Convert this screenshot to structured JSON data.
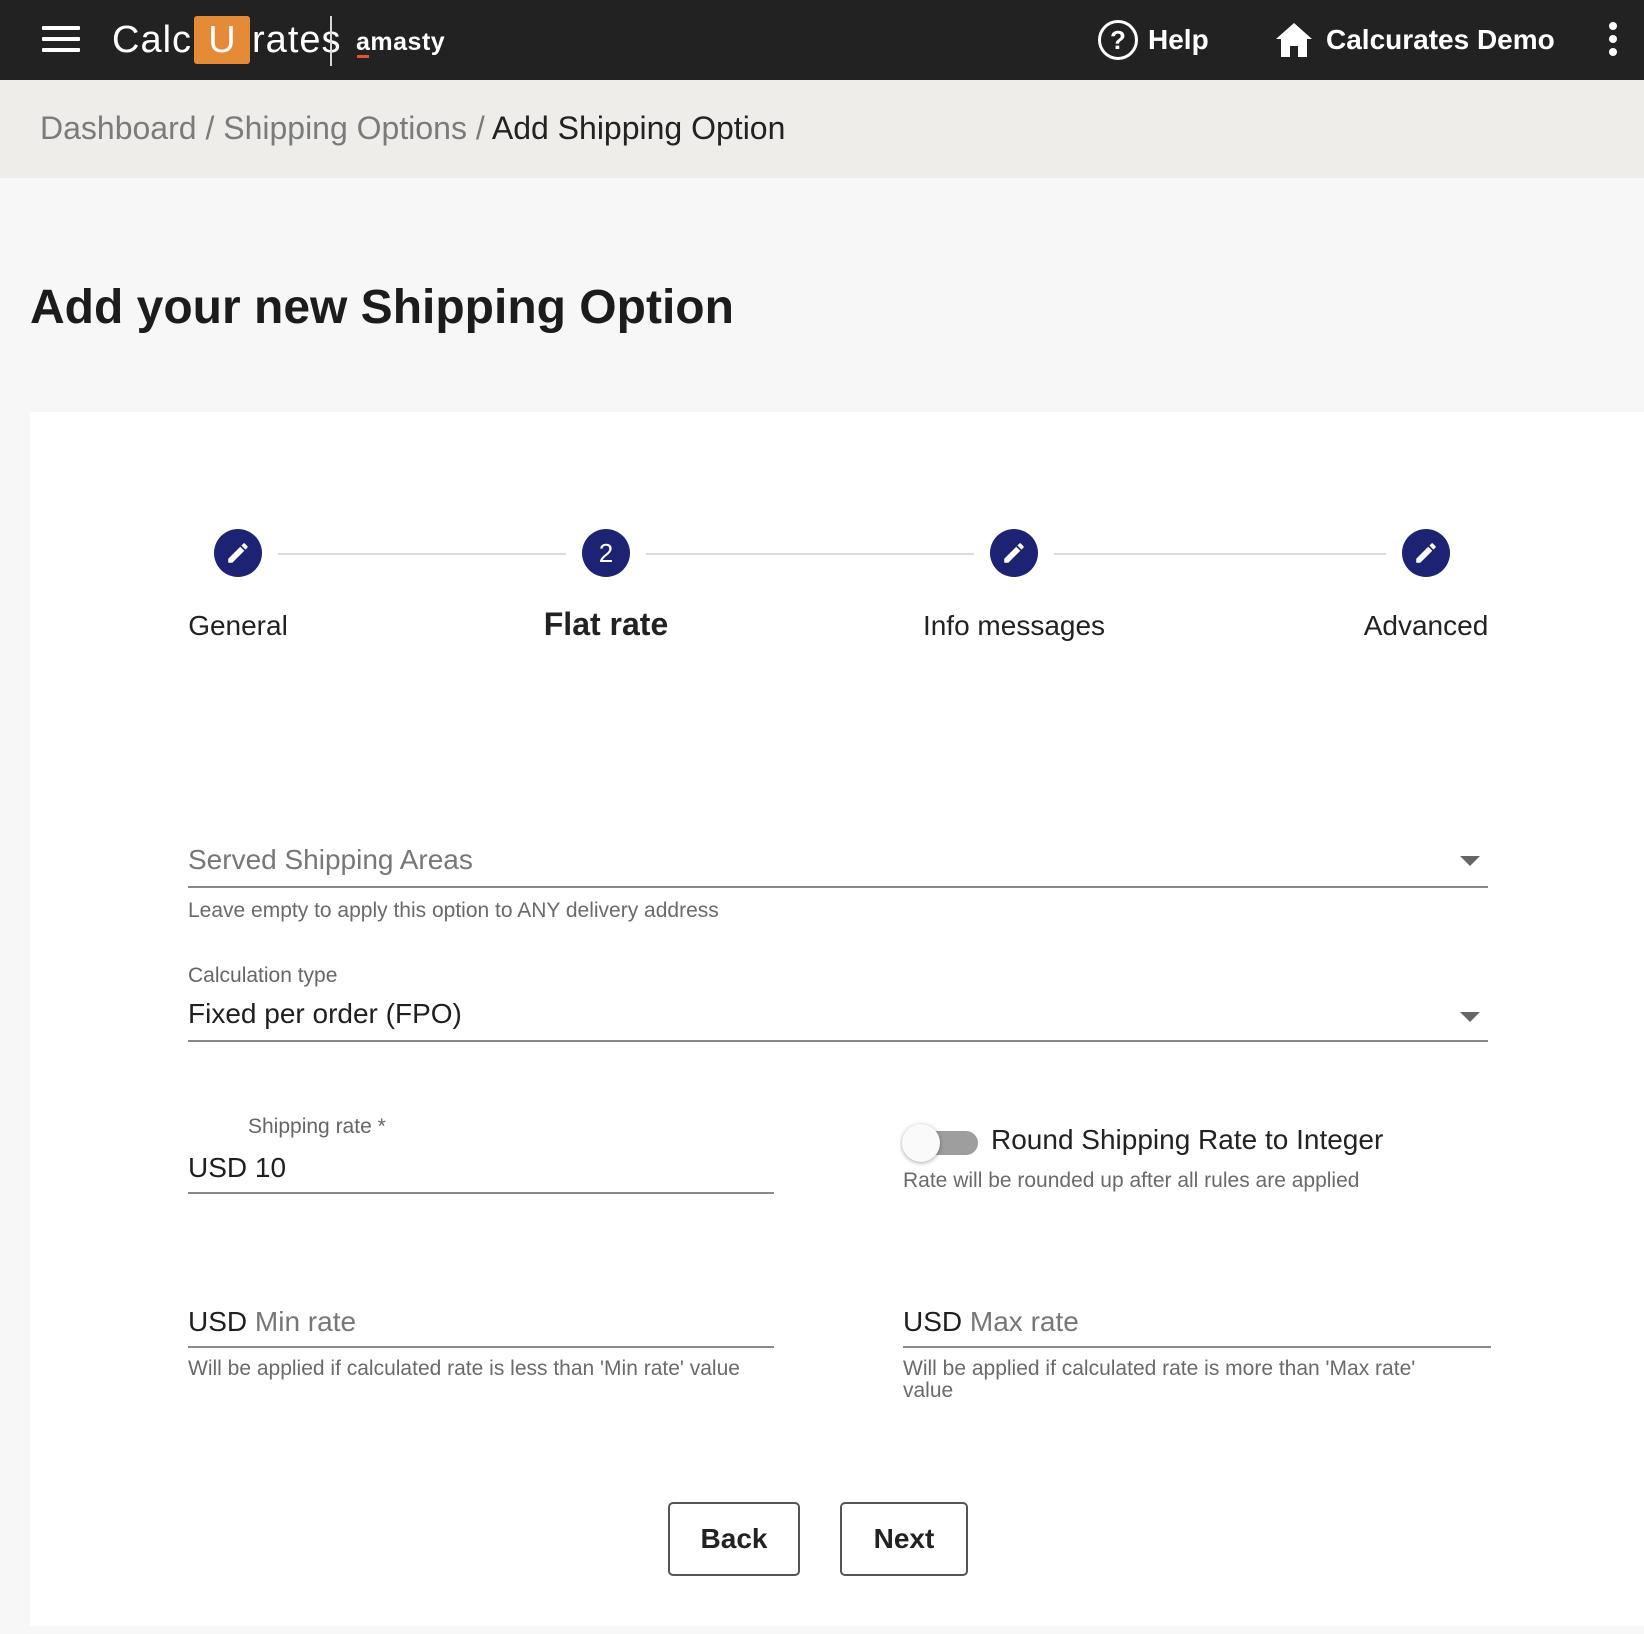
{
  "header": {
    "logo_left": "Calc",
    "logo_u": "U",
    "logo_right": "rates",
    "partner": "amasty",
    "help_label": "Help",
    "store_label": "Calcurates Demo"
  },
  "breadcrumb": {
    "items": [
      "Dashboard",
      "Shipping Options"
    ],
    "separator": " / ",
    "current": "Add Shipping Option"
  },
  "page": {
    "title": "Add your new Shipping Option"
  },
  "stepper": {
    "active_number": "2",
    "steps": [
      {
        "label": "General"
      },
      {
        "label": "Flat rate"
      },
      {
        "label": "Info messages"
      },
      {
        "label": "Advanced"
      }
    ]
  },
  "form": {
    "areas_placeholder": "Served Shipping Areas",
    "areas_hint": "Leave empty to apply this option to ANY delivery address",
    "calc_label": "Calculation type",
    "calc_value": "Fixed per order (FPO)",
    "rate_label": "Shipping rate *",
    "rate_currency": "USD",
    "rate_value": "10",
    "round_label": "Round Shipping Rate to Integer",
    "round_hint": "Rate will be rounded up after all rules are applied",
    "round_enabled": false,
    "min_currency": "USD",
    "min_placeholder": "Min rate",
    "min_hint": "Will be applied if calculated rate is less than 'Min rate' value",
    "max_currency": "USD",
    "max_placeholder": "Max rate",
    "max_hint": "Will be applied if calculated rate is more than 'Max rate' value"
  },
  "actions": {
    "back_label": "Back",
    "next_label": "Next"
  },
  "colors": {
    "topbar": "#222222",
    "accent": "#1e2272",
    "logo_orange": "#e58a36"
  }
}
